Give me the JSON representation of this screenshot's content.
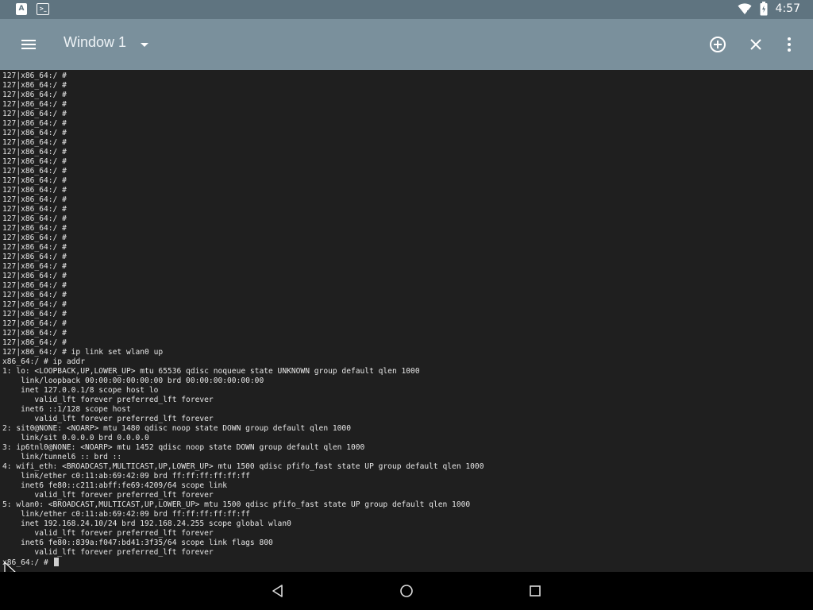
{
  "status_bar": {
    "time": "4:57",
    "left_icons": [
      "a-notification-icon",
      "terminal-notification-icon"
    ],
    "right_icons": [
      "wifi-icon",
      "battery-icon"
    ]
  },
  "app_bar": {
    "menu_icon": "menu-icon",
    "title": "Window 1",
    "dropdown_icon": "dropdown-arrow-icon",
    "actions": [
      "add-window-icon",
      "close-window-icon",
      "more-options-icon"
    ]
  },
  "terminal": {
    "lines": [
      "127|x86_64:/ #",
      "127|x86_64:/ #",
      "127|x86_64:/ #",
      "127|x86_64:/ #",
      "127|x86_64:/ #",
      "127|x86_64:/ #",
      "127|x86_64:/ #",
      "127|x86_64:/ #",
      "127|x86_64:/ #",
      "127|x86_64:/ #",
      "127|x86_64:/ #",
      "127|x86_64:/ #",
      "127|x86_64:/ #",
      "127|x86_64:/ #",
      "127|x86_64:/ #",
      "127|x86_64:/ #",
      "127|x86_64:/ #",
      "127|x86_64:/ #",
      "127|x86_64:/ #",
      "127|x86_64:/ #",
      "127|x86_64:/ #",
      "127|x86_64:/ #",
      "127|x86_64:/ #",
      "127|x86_64:/ #",
      "127|x86_64:/ #",
      "127|x86_64:/ #",
      "127|x86_64:/ #",
      "127|x86_64:/ #",
      "127|x86_64:/ #",
      "127|x86_64:/ # ip link set wlan0 up",
      "x86_64:/ # ip addr",
      "1: lo: <LOOPBACK,UP,LOWER_UP> mtu 65536 qdisc noqueue state UNKNOWN group default qlen 1000",
      "    link/loopback 00:00:00:00:00:00 brd 00:00:00:00:00:00",
      "    inet 127.0.0.1/8 scope host lo",
      "       valid_lft forever preferred_lft forever",
      "    inet6 ::1/128 scope host",
      "       valid_lft forever preferred_lft forever",
      "2: sit0@NONE: <NOARP> mtu 1480 qdisc noop state DOWN group default qlen 1000",
      "    link/sit 0.0.0.0 brd 0.0.0.0",
      "3: ip6tnl0@NONE: <NOARP> mtu 1452 qdisc noop state DOWN group default qlen 1000",
      "    link/tunnel6 :: brd ::",
      "4: wifi_eth: <BROADCAST,MULTICAST,UP,LOWER_UP> mtu 1500 qdisc pfifo_fast state UP group default qlen 1000",
      "    link/ether c0:11:ab:69:42:09 brd ff:ff:ff:ff:ff:ff",
      "    inet6 fe80::c211:abff:fe69:4209/64 scope link",
      "       valid_lft forever preferred_lft forever",
      "5: wlan0: <BROADCAST,MULTICAST,UP,LOWER_UP> mtu 1500 qdisc pfifo_fast state UP group default qlen 1000",
      "    link/ether c0:11:ab:69:42:09 brd ff:ff:ff:ff:ff:ff",
      "    inet 192.168.24.10/24 brd 192.168.24.255 scope global wlan0",
      "       valid_lft forever preferred_lft forever",
      "    inet6 fe80::839a:f047:bd41:3f35/64 scope link flags 800",
      "       valid_lft forever preferred_lft forever"
    ],
    "prompt": "x86_64:/ # "
  },
  "nav_bar": {
    "buttons": [
      "back-icon",
      "home-icon",
      "recents-icon"
    ]
  },
  "colors": {
    "status_bar": "#5f7480",
    "app_bar": "#7a909c",
    "terminal_bg": "#1f1f1f",
    "terminal_text": "#e6e6e6",
    "nav_bar": "#000000"
  }
}
